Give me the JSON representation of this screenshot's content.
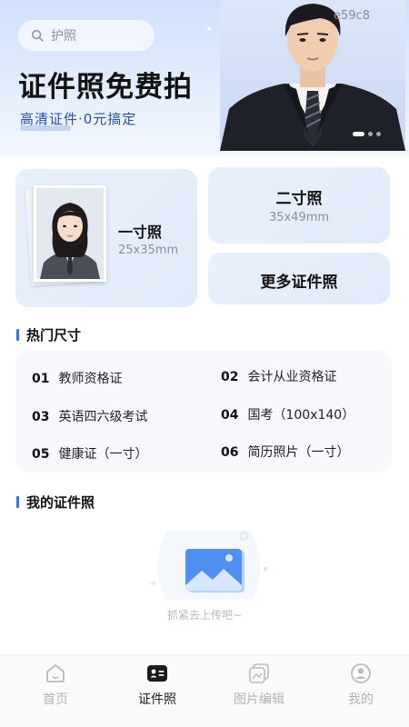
{
  "search": {
    "placeholder": "护照"
  },
  "hero": {
    "title": "证件照免费拍",
    "subtitle": "高清证件·0元搞定",
    "watermark": "e59c8",
    "carousel_pages": 3,
    "carousel_active": 1
  },
  "cards": {
    "one_inch": {
      "title": "一寸照",
      "size": "25x35mm"
    },
    "two_inch": {
      "title": "二寸照",
      "size": "35x49mm"
    },
    "more": {
      "title": "更多证件照"
    }
  },
  "popular": {
    "title": "热门尺寸",
    "items": [
      {
        "num": "01",
        "label": "教师资格证"
      },
      {
        "num": "02",
        "label": "会计从业资格证"
      },
      {
        "num": "03",
        "label": "英语四六级考试"
      },
      {
        "num": "04",
        "label": "国考（100x140）"
      },
      {
        "num": "05",
        "label": "健康证（一寸）"
      },
      {
        "num": "06",
        "label": "简历照片（一寸）"
      }
    ]
  },
  "my_photos": {
    "title": "我的证件照",
    "empty_text": "抓紧去上传吧~"
  },
  "nav": {
    "items": [
      {
        "label": "首页",
        "icon": "home-icon",
        "active": false
      },
      {
        "label": "证件照",
        "icon": "id-card-icon",
        "active": true
      },
      {
        "label": "图片编辑",
        "icon": "image-edit-icon",
        "active": false
      },
      {
        "label": "我的",
        "icon": "user-icon",
        "active": false
      }
    ]
  },
  "colors": {
    "accent": "#3f6fe0",
    "hero_bg": "#d6e4fb",
    "card_bg": "#e6eefb",
    "muted_text": "#8a8f99"
  }
}
